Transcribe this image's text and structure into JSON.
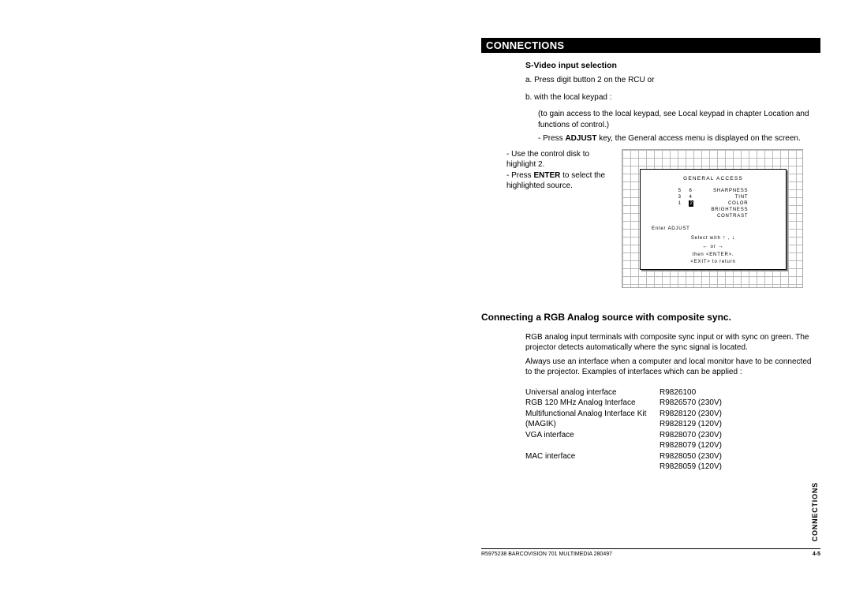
{
  "header": {
    "title": "CONNECTIONS"
  },
  "svideo": {
    "heading": "S-Video input selection",
    "line_a": "a. Press digit button 2 on the RCU or",
    "line_b": "b. with the local keypad :",
    "note": "(to gain access to the local keypad, see Local keypad in chapter Location and functions of control.)",
    "adjust_prefix": "- Press ",
    "adjust_bold": "ADJUST",
    "adjust_suffix": " key, the General access menu is displayed on the screen.",
    "use_disk": "- Use the control disk to highlight 2.",
    "enter_prefix": "- Press ",
    "enter_bold": "ENTER",
    "enter_suffix": " to select the highlighted source."
  },
  "panel": {
    "title": "GENERAL ACCESS",
    "nums": [
      [
        "5",
        "6"
      ],
      [
        "3",
        "4"
      ],
      [
        "1",
        "2"
      ]
    ],
    "highlight": "2",
    "settings": [
      "SHARPNESS",
      "TINT",
      "COLOR",
      "BRIGHTNESS",
      "CONTRAST"
    ],
    "enter_adjust": "Enter ADJUST",
    "select_with": "Select with",
    "or": "or",
    "then_enter": "then <ENTER>.",
    "exit": "<EXIT> to return"
  },
  "rgb": {
    "title": "Connecting a RGB Analog source with composite sync.",
    "para": "RGB analog input terminals with composite sync input or with sync on green.  The projector detects automatically where the sync signal is located.",
    "para2": "Always use an interface when a computer and local monitor have to be connected to the projector.  Examples of interfaces which can be applied :",
    "interfaces": [
      {
        "name": "Universal analog interface",
        "code": "R9826100"
      },
      {
        "name": "RGB 120 MHz Analog Interface",
        "code": "R9826570 (230V)"
      },
      {
        "name": "Multifunctional Analog Interface Kit",
        "code": "R9828120 (230V)"
      },
      {
        "name": "(MAGIK)",
        "code": "R9828129 (120V)"
      },
      {
        "name": "VGA interface",
        "code": "R9828070 (230V)"
      },
      {
        "name": "",
        "code": "R9828079 (120V)"
      },
      {
        "name": "MAC interface",
        "code": "R9828050 (230V)"
      },
      {
        "name": "",
        "code": "R9828059 (120V)"
      }
    ]
  },
  "side_label": "CONNECTIONS",
  "footer": {
    "left": "R5975238  BARCOVISION 701 MULTIMEDIA  280497",
    "right": "4-5"
  }
}
